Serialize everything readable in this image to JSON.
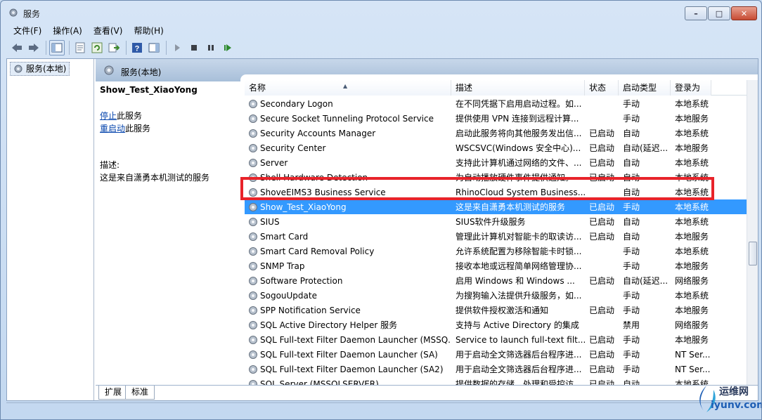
{
  "window": {
    "title": "服务",
    "buttons": [
      "–",
      "□",
      "✕"
    ]
  },
  "menu": [
    "文件(F)",
    "操作(A)",
    "查看(V)",
    "帮助(H)"
  ],
  "toolbar": [
    "back-icon",
    "forward-icon",
    "show-console-tree-icon",
    "properties-icon",
    "refresh-icon",
    "export-list-icon",
    "help-icon",
    "show-action-pane-icon",
    "start-service-icon",
    "stop-service-icon",
    "pause-service-icon",
    "restart-service-icon"
  ],
  "tree": {
    "item": "服务(本地)"
  },
  "panel": {
    "header": "服务(本地)"
  },
  "details": {
    "service_name": "Show_Test_XiaoYong",
    "stop_link": "停止",
    "stop_suffix": "此服务",
    "restart_link": "重启动",
    "restart_suffix": "此服务",
    "description_label": "描述:",
    "description": "这是来自潇勇本机测试的服务"
  },
  "columns": [
    "名称",
    "描述",
    "状态",
    "启动类型",
    "登录为"
  ],
  "rows": [
    {
      "name": "Secondary Logon",
      "desc": "在不同凭据下启用启动过程。如...",
      "status": "",
      "startup": "手动",
      "logon": "本地系统"
    },
    {
      "name": "Secure Socket Tunneling Protocol Service",
      "desc": "提供使用 VPN 连接到远程计算...",
      "status": "",
      "startup": "手动",
      "logon": "本地服务"
    },
    {
      "name": "Security Accounts Manager",
      "desc": "启动此服务将向其他服务发出信...",
      "status": "已启动",
      "startup": "自动",
      "logon": "本地系统"
    },
    {
      "name": "Security Center",
      "desc": "WSCSVC(Windows 安全中心)...",
      "status": "已启动",
      "startup": "自动(延迟...",
      "logon": "本地服务"
    },
    {
      "name": "Server",
      "desc": "支持此计算机通过网络的文件、...",
      "status": "已启动",
      "startup": "自动",
      "logon": "本地系统"
    },
    {
      "name": "Shell Hardware Detection",
      "desc": "为自动播放硬件事件提供通知。",
      "status": "已启动",
      "startup": "自动",
      "logon": "本地系统"
    },
    {
      "name": "ShoveEIMS3 Business Service",
      "desc": "RhinoCloud System Business...",
      "status": "",
      "startup": "自动",
      "logon": "本地系统"
    },
    {
      "name": "Show_Test_XiaoYong",
      "desc": "这是来自潇勇本机测试的服务",
      "status": "已启动",
      "startup": "手动",
      "logon": "本地系统",
      "selected": true
    },
    {
      "name": "SIUS",
      "desc": "SIUS软件升级服务",
      "status": "已启动",
      "startup": "自动",
      "logon": "本地系统"
    },
    {
      "name": "Smart Card",
      "desc": "管理此计算机对智能卡的取读访...",
      "status": "已启动",
      "startup": "自动",
      "logon": "本地服务"
    },
    {
      "name": "Smart Card Removal Policy",
      "desc": "允许系统配置为移除智能卡时锁...",
      "status": "",
      "startup": "手动",
      "logon": "本地系统"
    },
    {
      "name": "SNMP Trap",
      "desc": "接收本地或远程简单网络管理协...",
      "status": "",
      "startup": "手动",
      "logon": "本地服务"
    },
    {
      "name": "Software Protection",
      "desc": "启用 Windows 和 Windows ...",
      "status": "已启动",
      "startup": "自动(延迟...",
      "logon": "网络服务"
    },
    {
      "name": "SogouUpdate",
      "desc": "为搜狗输入法提供升级服务，如...",
      "status": "",
      "startup": "手动",
      "logon": "本地系统"
    },
    {
      "name": "SPP Notification Service",
      "desc": "提供软件授权激活和通知",
      "status": "已启动",
      "startup": "手动",
      "logon": "本地服务"
    },
    {
      "name": "SQL Active Directory Helper 服务",
      "desc": "支持与 Active Directory 的集成",
      "status": "",
      "startup": "禁用",
      "logon": "网络服务"
    },
    {
      "name": "SQL Full-text Filter Daemon Launcher (MSSQ...",
      "desc": "Service to launch full-text filt...",
      "status": "已启动",
      "startup": "手动",
      "logon": "本地服务"
    },
    {
      "name": "SQL Full-text Filter Daemon Launcher (SA)",
      "desc": "用于启动全文筛选器后台程序进...",
      "status": "已启动",
      "startup": "手动",
      "logon": "NT Ser..."
    },
    {
      "name": "SQL Full-text Filter Daemon Launcher (SA2)",
      "desc": "用于启动全文筛选器后台程序进...",
      "status": "已启动",
      "startup": "手动",
      "logon": "NT Ser..."
    },
    {
      "name": "SQL Server (MSSQLSERVER)",
      "desc": "提供数据的存储、处理和受控访...",
      "status": "已启动",
      "startup": "自动",
      "logon": "本地系统"
    }
  ],
  "tabs": [
    "扩展",
    "标准"
  ],
  "watermark": {
    "line1": "运维网",
    "line2": "iyunv.com"
  },
  "colors": {
    "selected_row": "#3399ff",
    "highlight_box": "#e8232a",
    "link": "#0645ad"
  }
}
